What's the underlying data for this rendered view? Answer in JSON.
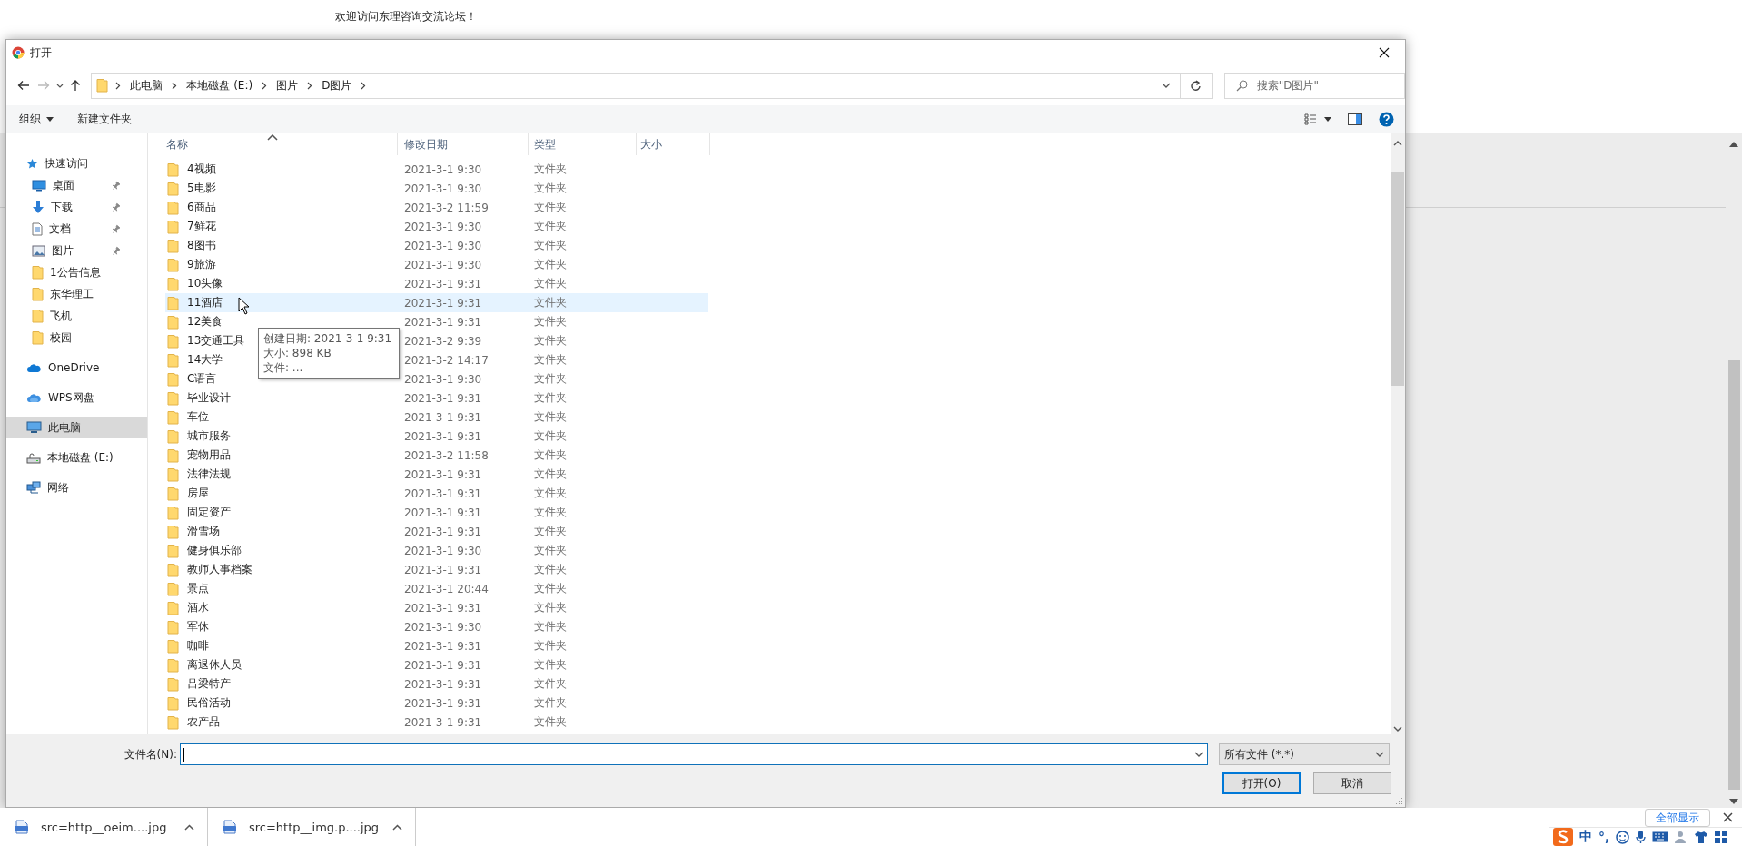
{
  "page": {
    "welcome": "欢迎访问东理咨询交流论坛！"
  },
  "dialog": {
    "title": "打开",
    "breadcrumb": [
      "此电脑",
      "本地磁盘 (E:)",
      "图片",
      "D图片"
    ],
    "search": {
      "placeholder": "搜索\"D图片\""
    },
    "toolbar": [
      {
        "label": "组织",
        "dropdown": true
      },
      {
        "label": "新建文件夹",
        "dropdown": false
      }
    ],
    "sidebar": [
      {
        "label": "快速访问",
        "kind": "star",
        "selected": false,
        "children": [
          {
            "label": "桌面",
            "kind": "desktop",
            "pinned": true,
            "selected": false
          },
          {
            "label": "下载",
            "kind": "download",
            "pinned": true,
            "selected": false
          },
          {
            "label": "文档",
            "kind": "document",
            "pinned": true,
            "selected": false
          },
          {
            "label": "图片",
            "kind": "picture",
            "pinned": true,
            "selected": false
          },
          {
            "label": "1公告信息",
            "kind": "folder",
            "pinned": false,
            "selected": false
          },
          {
            "label": "东华理工",
            "kind": "folder",
            "pinned": false,
            "selected": false
          },
          {
            "label": "飞机",
            "kind": "folder",
            "pinned": false,
            "selected": false
          },
          {
            "label": "校园",
            "kind": "folder",
            "pinned": false,
            "selected": false
          }
        ]
      },
      {
        "label": "OneDrive",
        "kind": "cloud",
        "selected": false
      },
      {
        "label": "WPS网盘",
        "kind": "cloud2",
        "selected": false
      },
      {
        "label": "此电脑",
        "kind": "pc",
        "selected": true
      },
      {
        "label": "本地磁盘 (E:)",
        "kind": "drive",
        "selected": false
      },
      {
        "label": "网络",
        "kind": "network",
        "selected": false
      }
    ],
    "columns": [
      {
        "label": "名称",
        "sorted": true
      },
      {
        "label": "修改日期",
        "sorted": false
      },
      {
        "label": "类型",
        "sorted": false
      },
      {
        "label": "大小",
        "sorted": false
      }
    ],
    "rows": [
      {
        "name": "4视频",
        "modified": "2021-3-1 9:30",
        "type": "文件夹",
        "hovered": false
      },
      {
        "name": "5电影",
        "modified": "2021-3-1 9:30",
        "type": "文件夹",
        "hovered": false
      },
      {
        "name": "6商品",
        "modified": "2021-3-2 11:59",
        "type": "文件夹",
        "hovered": false
      },
      {
        "name": "7鲜花",
        "modified": "2021-3-1 9:30",
        "type": "文件夹",
        "hovered": false
      },
      {
        "name": "8图书",
        "modified": "2021-3-1 9:30",
        "type": "文件夹",
        "hovered": false
      },
      {
        "name": "9旅游",
        "modified": "2021-3-1 9:30",
        "type": "文件夹",
        "hovered": false
      },
      {
        "name": "10头像",
        "modified": "2021-3-1 9:31",
        "type": "文件夹",
        "hovered": false
      },
      {
        "name": "11酒店",
        "modified": "2021-3-1 9:31",
        "type": "文件夹",
        "hovered": true
      },
      {
        "name": "12美食",
        "modified": "2021-3-1 9:31",
        "type": "文件夹",
        "hovered": false
      },
      {
        "name": "13交通工具",
        "modified": "2021-3-2 9:39",
        "type": "文件夹",
        "hovered": false
      },
      {
        "name": "14大学",
        "modified": "2021-3-2 14:17",
        "type": "文件夹",
        "hovered": false
      },
      {
        "name": "C语言",
        "modified": "2021-3-1 9:30",
        "type": "文件夹",
        "hovered": false
      },
      {
        "name": "毕业设计",
        "modified": "2021-3-1 9:31",
        "type": "文件夹",
        "hovered": false
      },
      {
        "name": "车位",
        "modified": "2021-3-1 9:31",
        "type": "文件夹",
        "hovered": false
      },
      {
        "name": "城市服务",
        "modified": "2021-3-1 9:31",
        "type": "文件夹",
        "hovered": false
      },
      {
        "name": "宠物用品",
        "modified": "2021-3-2 11:58",
        "type": "文件夹",
        "hovered": false
      },
      {
        "name": "法律法规",
        "modified": "2021-3-1 9:31",
        "type": "文件夹",
        "hovered": false
      },
      {
        "name": "房屋",
        "modified": "2021-3-1 9:31",
        "type": "文件夹",
        "hovered": false
      },
      {
        "name": "固定资产",
        "modified": "2021-3-1 9:31",
        "type": "文件夹",
        "hovered": false
      },
      {
        "name": "滑雪场",
        "modified": "2021-3-1 9:31",
        "type": "文件夹",
        "hovered": false
      },
      {
        "name": "健身俱乐部",
        "modified": "2021-3-1 9:30",
        "type": "文件夹",
        "hovered": false
      },
      {
        "name": "教师人事档案",
        "modified": "2021-3-1 9:31",
        "type": "文件夹",
        "hovered": false
      },
      {
        "name": "景点",
        "modified": "2021-3-1 20:44",
        "type": "文件夹",
        "hovered": false
      },
      {
        "name": "酒水",
        "modified": "2021-3-1 9:31",
        "type": "文件夹",
        "hovered": false
      },
      {
        "name": "军休",
        "modified": "2021-3-1 9:30",
        "type": "文件夹",
        "hovered": false
      },
      {
        "name": "咖啡",
        "modified": "2021-3-1 9:31",
        "type": "文件夹",
        "hovered": false
      },
      {
        "name": "离退休人员",
        "modified": "2021-3-1 9:31",
        "type": "文件夹",
        "hovered": false
      },
      {
        "name": "吕梁特产",
        "modified": "2021-3-1 9:31",
        "type": "文件夹",
        "hovered": false
      },
      {
        "name": "民俗活动",
        "modified": "2021-3-1 9:31",
        "type": "文件夹",
        "hovered": false
      },
      {
        "name": "农产品",
        "modified": "2021-3-1 9:31",
        "type": "文件夹",
        "hovered": false
      }
    ],
    "tooltip": [
      "创建日期: 2021-3-1 9:31",
      "大小: 898 KB",
      "文件: ..."
    ],
    "filename_label": "文件名(N):",
    "filter": "所有文件 (*.*)",
    "buttons": [
      {
        "label": "打开(O)",
        "default": true
      },
      {
        "label": "取消",
        "default": false
      }
    ]
  },
  "downloads": {
    "items": [
      "src=http__oeim....jpg",
      "src=http__img.p....jpg"
    ],
    "show_all": "全部显示"
  },
  "ime": {
    "labels": [
      "中",
      "°,"
    ]
  }
}
